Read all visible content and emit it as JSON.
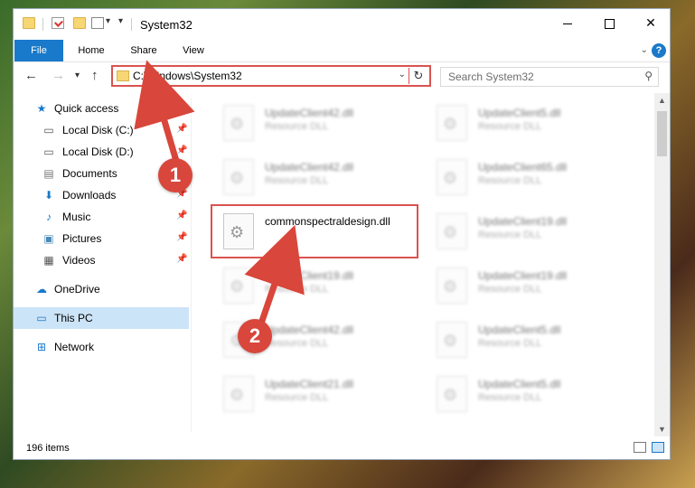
{
  "window": {
    "title": "System32",
    "controls": {
      "minimize": "",
      "maximize": "",
      "close": "✕"
    }
  },
  "ribbon": {
    "tabs": [
      "File",
      "Home",
      "Share",
      "View"
    ],
    "help": "?"
  },
  "nav": {
    "address": "C:\\Windows\\System32",
    "search_placeholder": "Search System32"
  },
  "sidebar": {
    "items": [
      {
        "label": "Quick access",
        "icon": "star-icon",
        "pinned": false
      },
      {
        "label": "Local Disk (C:)",
        "icon": "drive-icon",
        "pinned": true
      },
      {
        "label": "Local Disk (D:)",
        "icon": "drive-icon",
        "pinned": true
      },
      {
        "label": "Documents",
        "icon": "documents-icon",
        "pinned": true
      },
      {
        "label": "Downloads",
        "icon": "download-icon",
        "pinned": true
      },
      {
        "label": "Music",
        "icon": "music-icon",
        "pinned": true
      },
      {
        "label": "Pictures",
        "icon": "pictures-icon",
        "pinned": true
      },
      {
        "label": "Videos",
        "icon": "videos-icon",
        "pinned": true
      },
      {
        "label": "OneDrive",
        "icon": "cloud-icon",
        "pinned": false
      },
      {
        "label": "This PC",
        "icon": "computer-icon",
        "pinned": false,
        "selected": true
      },
      {
        "label": "Network",
        "icon": "network-icon",
        "pinned": false
      }
    ]
  },
  "files": [
    {
      "name": "UpdateClient42.dll",
      "type": "Resource DLL",
      "blurred": true
    },
    {
      "name": "UpdateClient5.dll",
      "type": "Resource DLL",
      "blurred": true
    },
    {
      "name": "UpdateClient42.dll",
      "type": "Resource DLL",
      "blurred": true
    },
    {
      "name": "UpdateClient65.dll",
      "type": "Resource DLL",
      "blurred": true
    },
    {
      "name": "commonspectraldesign.dll",
      "type": "",
      "blurred": false,
      "highlighted": true
    },
    {
      "name": "UpdateClient19.dll",
      "type": "Resource DLL",
      "blurred": true
    },
    {
      "name": "UpdateClient19.dll",
      "type": "Resource DLL",
      "blurred": true
    },
    {
      "name": "UpdateClient19.dll",
      "type": "Resource DLL",
      "blurred": true
    },
    {
      "name": "UpdateClient42.dll",
      "type": "Resource DLL",
      "blurred": true
    },
    {
      "name": "UpdateClient5.dll",
      "type": "Resource DLL",
      "blurred": true
    },
    {
      "name": "UpdateClient21.dll",
      "type": "Resource DLL",
      "blurred": true
    },
    {
      "name": "UpdateClient5.dll",
      "type": "Resource DLL",
      "blurred": true
    }
  ],
  "status": {
    "item_count": "196 items"
  },
  "callouts": [
    {
      "number": "1"
    },
    {
      "number": "2"
    }
  ],
  "colors": {
    "accent": "#1979ca",
    "highlight": "#d9534f",
    "badge": "#d9463b"
  }
}
